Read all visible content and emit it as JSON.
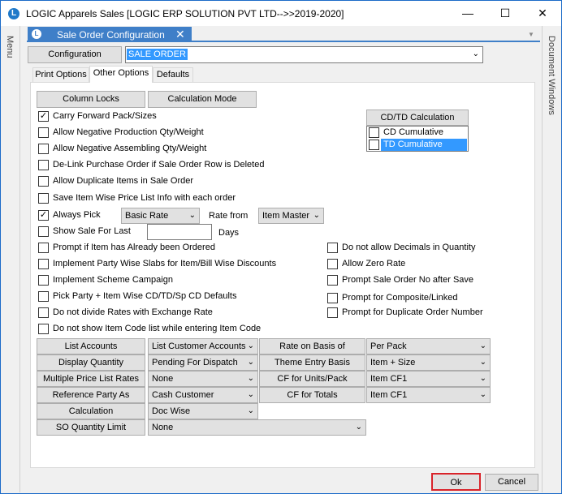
{
  "window": {
    "title": "LOGIC Apparels Sales  [LOGIC ERP SOLUTION PVT LTD-->>2019-2020]",
    "logo_letter": "L",
    "minimize_glyph": "—",
    "maximize_glyph": "☐",
    "close_glyph": "✕"
  },
  "side": {
    "left_label": "Menu",
    "right_label": "Document Windows"
  },
  "doc_tab": {
    "label": "Sale Order Configuration",
    "close_glyph": "✕",
    "icon_letter": "L"
  },
  "config": {
    "button_label": "Configuration",
    "selected_value": "SALE ORDER"
  },
  "tabs": [
    {
      "label": "Print Options"
    },
    {
      "label": "Other Options"
    },
    {
      "label": "Defaults"
    }
  ],
  "buttons": {
    "column_locks": "Column Locks",
    "calculation_mode": "Calculation Mode"
  },
  "cdtd": {
    "title": "CD/TD Calculation",
    "items": [
      {
        "label": "CD Cumulative",
        "checked": false
      },
      {
        "label": "TD Cumulative",
        "checked": false
      }
    ]
  },
  "left_checks": [
    {
      "label": "Carry Forward Pack/Sizes",
      "checked": true
    },
    {
      "label": "Allow Negative Production Qty/Weight",
      "checked": false
    },
    {
      "label": "Allow Negative Assembling Qty/Weight",
      "checked": false
    },
    {
      "label": "De-Link Purchase Order if Sale Order Row is Deleted",
      "checked": false
    },
    {
      "label": "Allow Duplicate Items in Sale Order",
      "checked": false
    },
    {
      "label": "Save Item Wise Price List Info with each order",
      "checked": false
    },
    {
      "label": "Always Pick",
      "checked": true
    },
    {
      "label": "Show Sale For Last",
      "checked": false
    },
    {
      "label": "Prompt  if Item has Already been Ordered",
      "checked": false
    },
    {
      "label": "Implement Party Wise Slabs for Item/Bill Wise Discounts",
      "checked": false
    },
    {
      "label": "Implement Scheme Campaign",
      "checked": false
    },
    {
      "label": "Pick Party + Item Wise CD/TD/Sp CD Defaults",
      "checked": false
    },
    {
      "label": "Do not divide Rates with Exchange Rate",
      "checked": false
    },
    {
      "label": "Do not show Item Code list while entering Item Code",
      "checked": false
    }
  ],
  "always_pick": {
    "value": "Basic Rate",
    "rate_from_label": "Rate from",
    "rate_from_value": "Item Master"
  },
  "show_sale": {
    "days_label": "Days",
    "value": ""
  },
  "right_checks": [
    {
      "label": "Do not allow Decimals in Quantity",
      "checked": false
    },
    {
      "label": "Allow Zero Rate",
      "checked": false
    },
    {
      "label": "Prompt Sale Order No after Save",
      "checked": false
    },
    {
      "label": "Prompt for Composite/Linked",
      "checked": false
    },
    {
      "label": "Prompt for Duplicate Order Number",
      "checked": false
    }
  ],
  "grid_left": [
    {
      "label": "List Accounts",
      "value": "List Customer Accounts"
    },
    {
      "label": "Display Quantity",
      "value": "Pending For Dispatch"
    },
    {
      "label": "Multiple Price List Rates",
      "value": "None"
    },
    {
      "label": "Reference Party As",
      "value": "Cash Customer"
    },
    {
      "label": "Calculation",
      "value": "Doc Wise"
    },
    {
      "label": "SO Quantity Limit",
      "value": "None"
    }
  ],
  "grid_right": [
    {
      "label": "Rate on Basis of",
      "value": "Per Pack"
    },
    {
      "label": "Theme Entry Basis",
      "value": "Item + Size"
    },
    {
      "label": "CF for Units/Pack",
      "value": "Item CF1"
    },
    {
      "label": "CF for Totals",
      "value": "Item CF1"
    }
  ],
  "footer": {
    "ok": "Ok",
    "cancel": "Cancel"
  },
  "colors": {
    "accent": "#3f7fc8",
    "selection": "#3399ff",
    "ok_border": "#d9232a",
    "window_border": "#1b6bc8"
  },
  "icons": {
    "dropdown": "▼",
    "check": "✓"
  }
}
